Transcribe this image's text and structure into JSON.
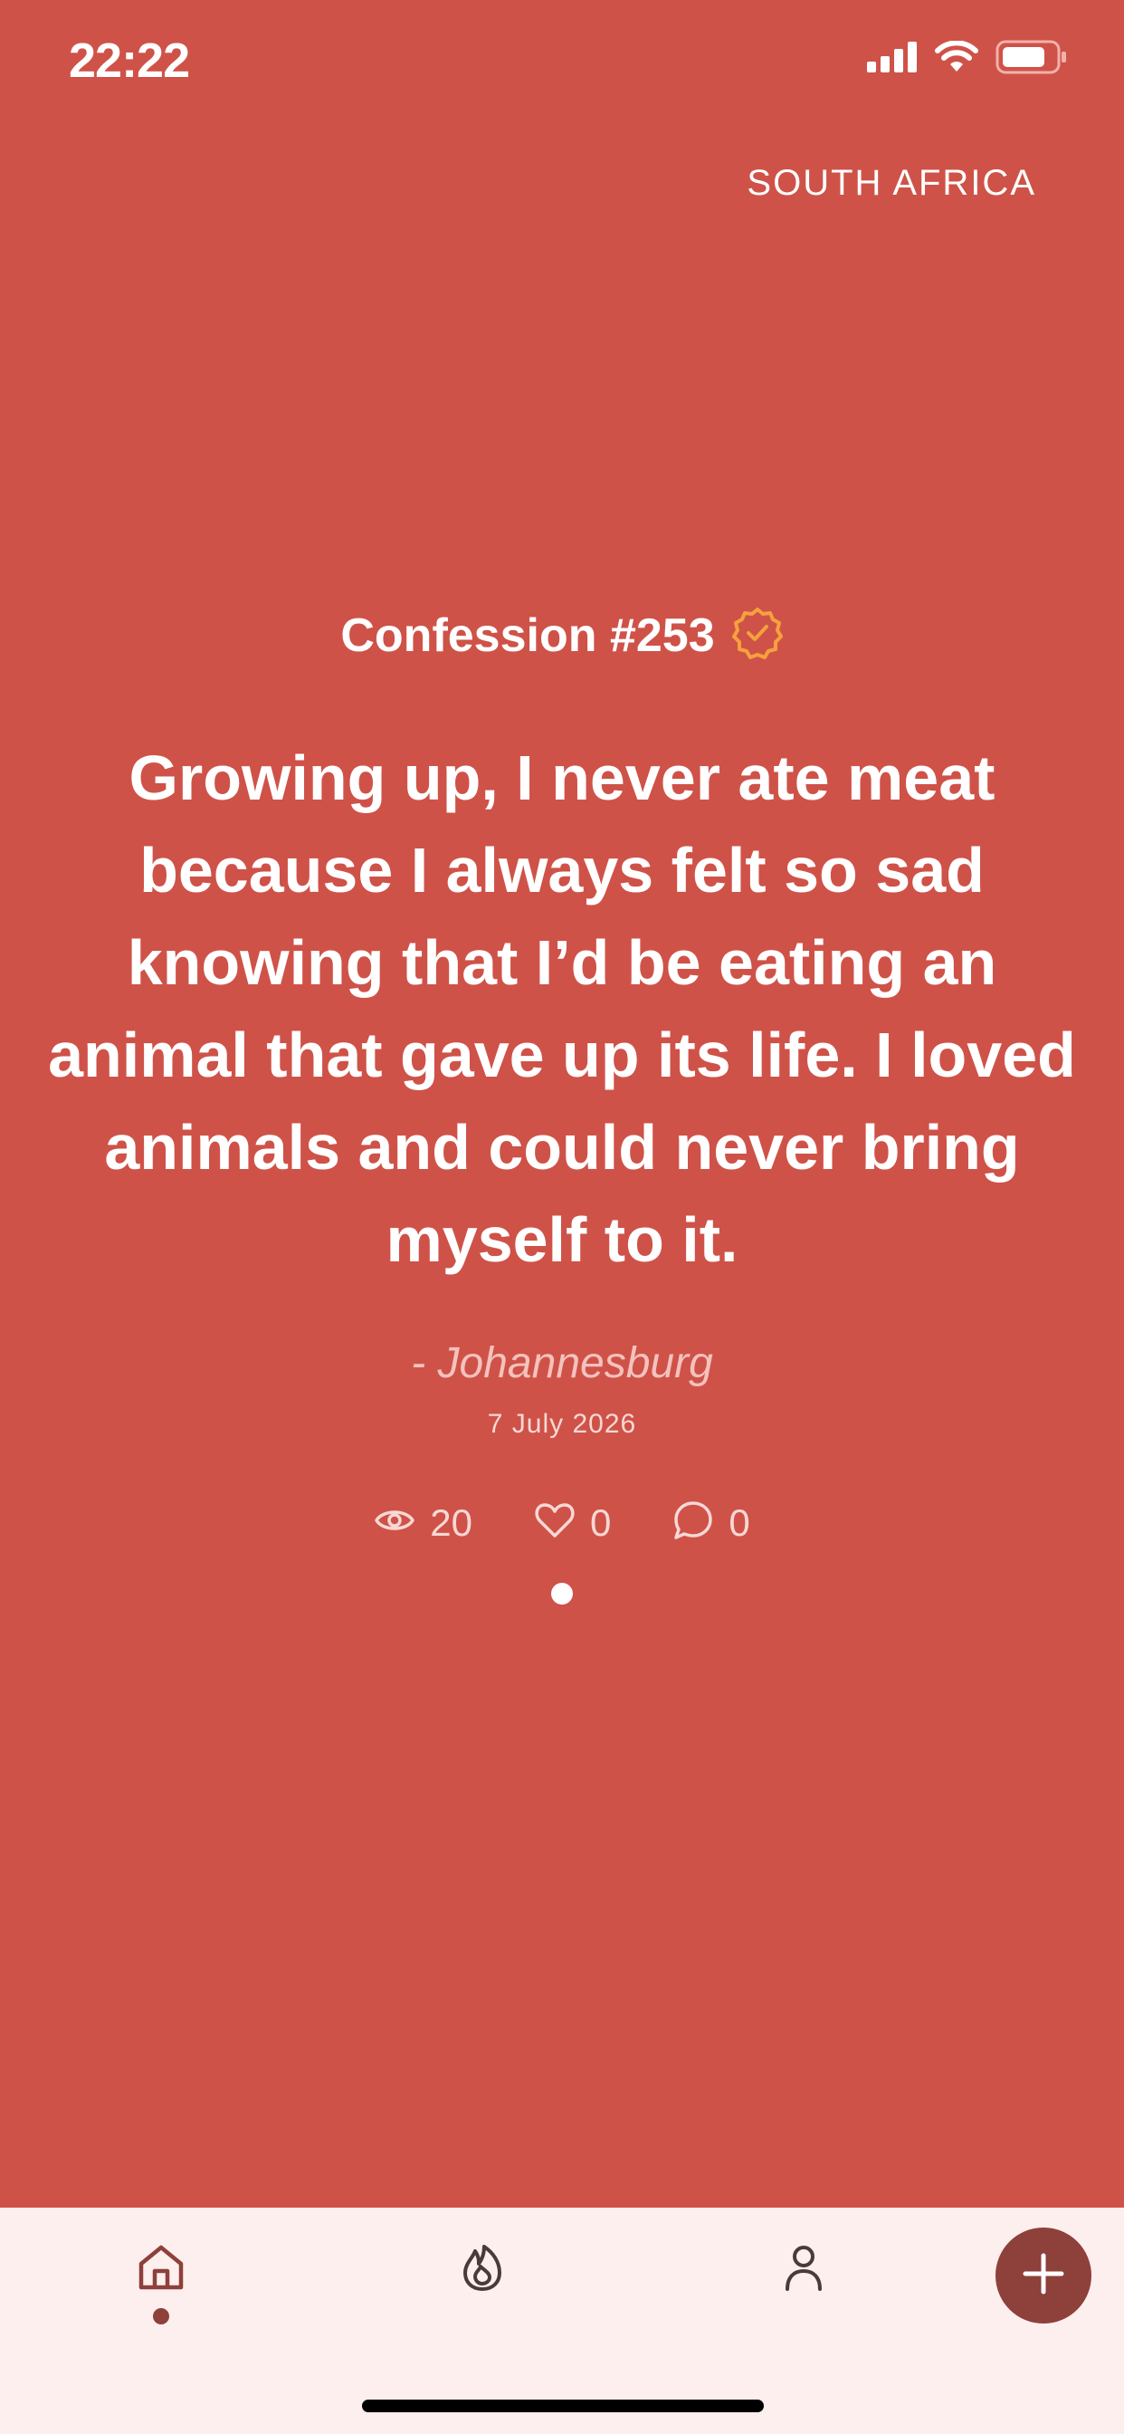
{
  "status_bar": {
    "time": "22:22"
  },
  "region": {
    "label": "SOUTH AFRICA"
  },
  "confession": {
    "title": "Confession #253",
    "text": "Growing up, I never ate meat because I always felt so sad knowing that I’d be eating an animal that gave up its life. I loved animals and could never bring myself to it.",
    "location": "- Johannesburg",
    "date": "7 July 2026",
    "views": "20",
    "likes": "0",
    "comments": "0"
  },
  "icons": {
    "verified": "verified-badge-icon",
    "views": "eye-icon",
    "likes": "heart-icon",
    "comments": "chat-bubble-icon",
    "home": "home-icon",
    "hot": "flame-icon",
    "profile": "person-icon",
    "add": "plus-icon"
  },
  "colors": {
    "background": "#cf5248",
    "nav_background": "#fcefee",
    "accent": "#8e403b",
    "verified_badge": "#f5a13d"
  }
}
